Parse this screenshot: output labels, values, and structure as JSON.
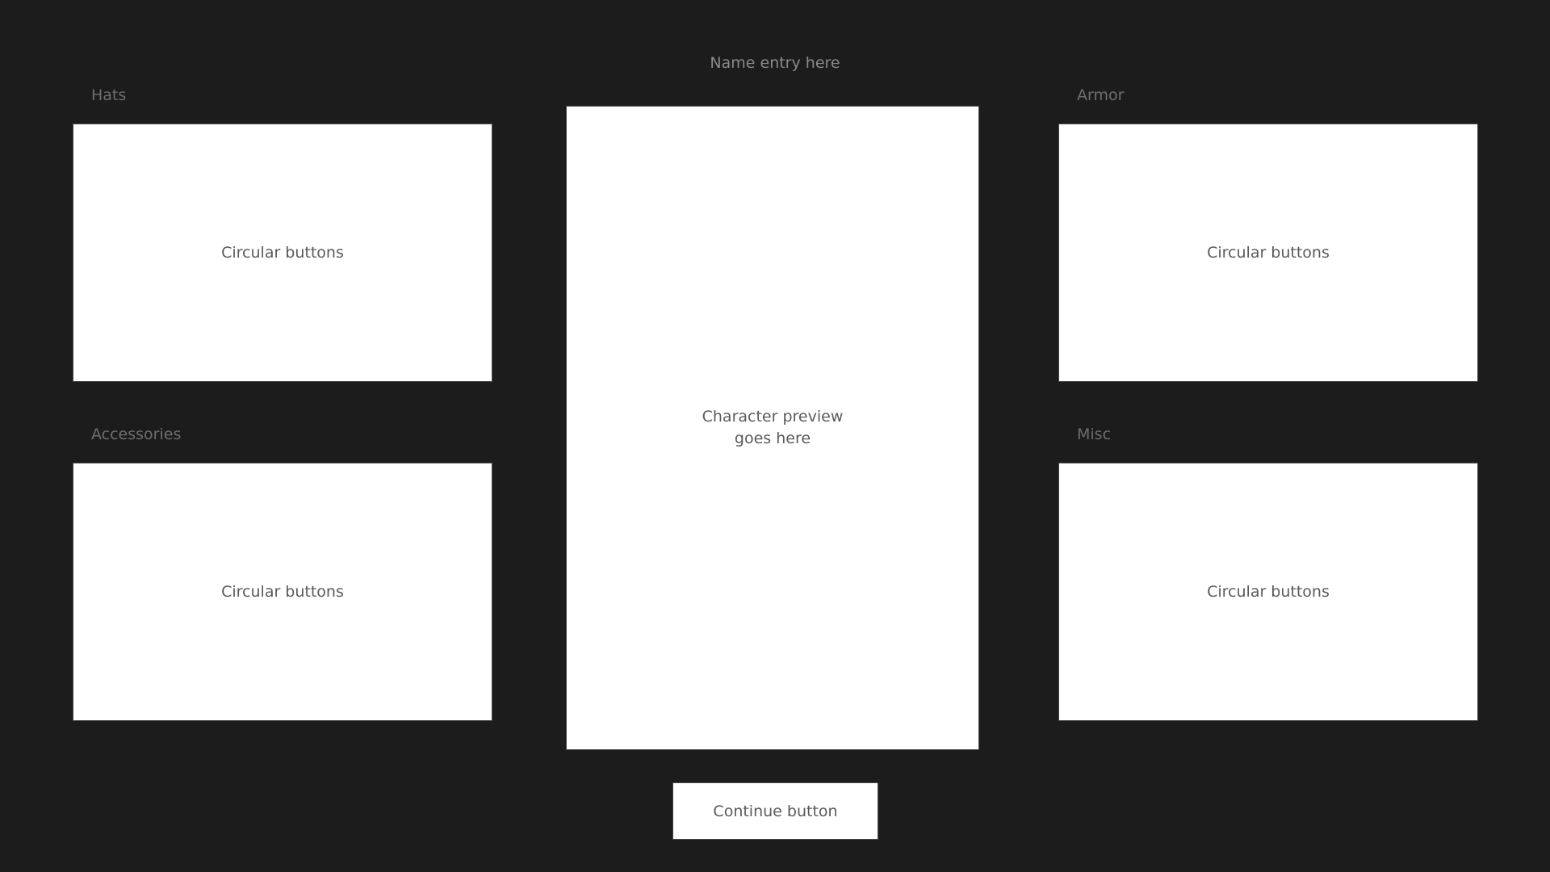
{
  "name_entry": {
    "placeholder": "Name entry here"
  },
  "sections": {
    "hats": {
      "label": "Hats",
      "content": "Circular buttons"
    },
    "accessories": {
      "label": "Accessories",
      "content": "Circular buttons"
    },
    "armor": {
      "label": "Armor",
      "content": "Circular buttons"
    },
    "misc": {
      "label": "Misc",
      "content": "Circular buttons"
    }
  },
  "preview": {
    "text": "Character preview\ngoes here"
  },
  "continue": {
    "label": "Continue button"
  },
  "colors": {
    "background": "#1c1c1c",
    "panel": "#ffffff",
    "label_text": "#6e6e6e",
    "panel_text": "#5a5a5a"
  }
}
